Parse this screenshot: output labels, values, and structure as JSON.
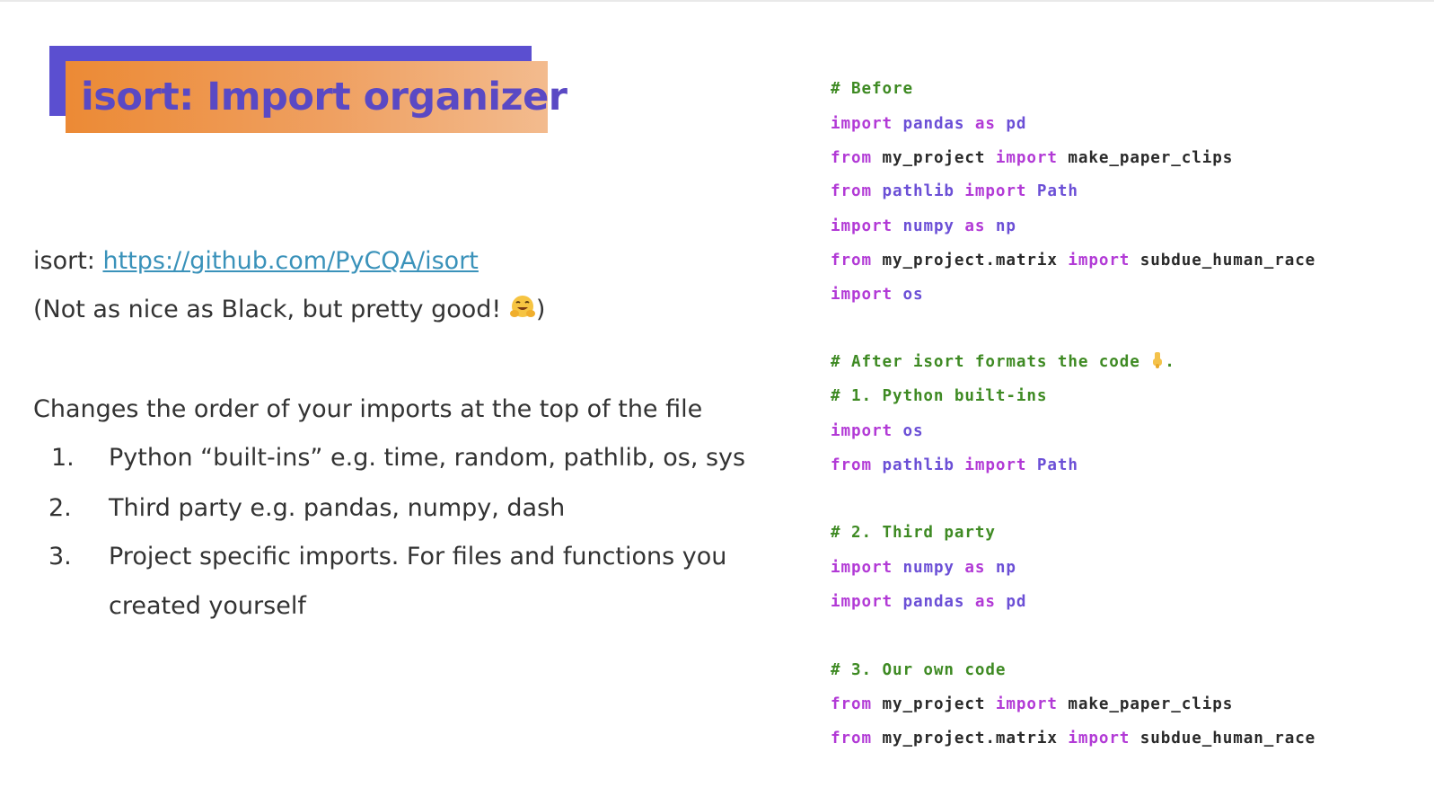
{
  "title": "isort: Import organizer",
  "left": {
    "isort_label": "isort: ",
    "isort_link": "https://github.com/PyCQA/isort",
    "note_open": "(Not as nice as Black, but pretty good! ",
    "note_emoji": "hugging-face-emoji",
    "note_close": ")",
    "intro": "Changes the order of your imports at the top of the file",
    "list": [
      {
        "num": "1.",
        "text": "Python “built-ins” e.g. time, random, pathlib, os, sys"
      },
      {
        "num": "2.",
        "text": "Third party e.g. pandas, numpy, dash"
      },
      {
        "num": "3.",
        "text": "Project specific imports. For files and functions you",
        "text2": "created yourself"
      }
    ]
  },
  "code": {
    "before_comment": "# Before",
    "before": [
      {
        "k1": "import",
        "m1": " pandas ",
        "k2": "as",
        "m2": " pd"
      },
      {
        "k1": "from",
        "t1": " my_project ",
        "k2": "import",
        "t2": " make_paper_clips"
      },
      {
        "k1": "from",
        "m1": " pathlib ",
        "k2": "import",
        "m2": " Path"
      },
      {
        "k1": "import",
        "m1": " numpy ",
        "k2": "as",
        "m2": " np"
      },
      {
        "k1": "from",
        "t1": " my_project.matrix ",
        "k2": "import",
        "t2": " subdue_human_race"
      },
      {
        "k1": "import",
        "m1": " os"
      }
    ],
    "after_comment": "# After isort formats the code ",
    "after_icon": "pointing-down-emoji",
    "after_dot": ".",
    "builtins_comment": "# 1. Python built-ins",
    "builtins": [
      {
        "k1": "import",
        "m1": " os"
      },
      {
        "k1": "from",
        "m1": " pathlib ",
        "k2": "import",
        "m2": " Path"
      }
    ],
    "third_comment": "# 2. Third party",
    "third": [
      {
        "k1": "import",
        "m1": " numpy ",
        "k2": "as",
        "m2": " np"
      },
      {
        "k1": "import",
        "m1": " pandas ",
        "k2": "as",
        "m2": " pd"
      }
    ],
    "own_comment": "# 3. Our own code",
    "own": [
      {
        "k1": "from",
        "t1": " my_project ",
        "k2": "import",
        "t2": " make_paper_clips"
      },
      {
        "k1": "from",
        "t1": " my_project.matrix ",
        "k2": "import",
        "t2": " subdue_human_race"
      }
    ]
  }
}
